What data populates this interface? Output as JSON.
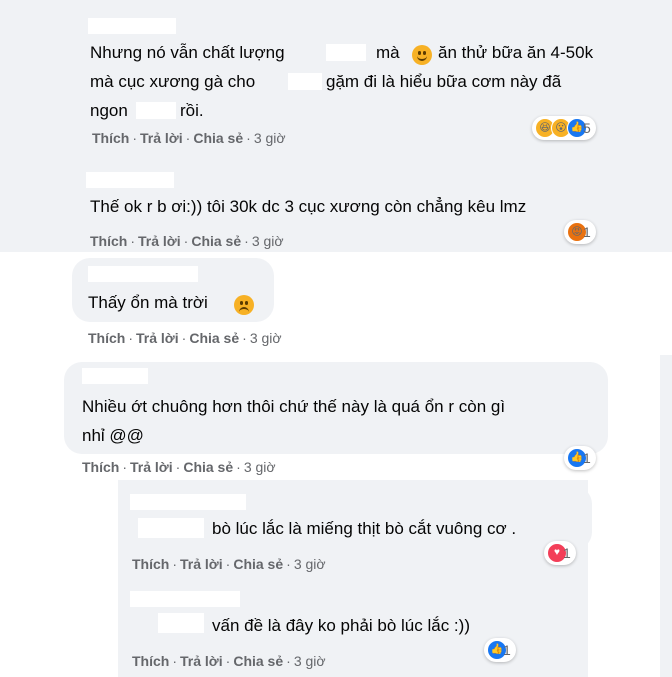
{
  "actions": {
    "like": "Thích",
    "reply": "Trả lời",
    "share": "Chia sẻ",
    "separator": "·",
    "time": "3 giờ"
  },
  "comments": [
    {
      "lines": [
        "Nhưng nó vẫn chất lượng",
        "mà",
        "ăn thử bữa ăn 4-50k",
        "mà cục xương gà cho",
        "gặm đi là hiểu bữa cơm này đã",
        "ngon",
        "rồi."
      ],
      "reactions": [
        "haha-icon",
        "wow-icon",
        "like-icon"
      ],
      "reaction_count": "5"
    },
    {
      "text": "Thế ok r b ơi:)) tôi 30k dc 3 cục xương còn chẳng kêu lmz",
      "reactions": [
        "angry-icon"
      ],
      "reaction_count": "1"
    },
    {
      "text": "Thấy ổn mà trời",
      "reactions": [],
      "reaction_count": ""
    },
    {
      "lines": [
        "Nhiều ớt chuông hơn thôi chứ thế này là quá ổn r còn gì",
        "nhỉ @@"
      ],
      "reactions": [
        "like-icon"
      ],
      "reaction_count": "1"
    },
    {
      "text": "bò lúc lắc là miếng thịt bò cắt vuông cơ .",
      "reactions": [
        "love-icon"
      ],
      "reaction_count": "1"
    },
    {
      "text": "vấn đề là đây ko phải bò lúc lắc :))",
      "reactions": [
        "like-icon"
      ],
      "reaction_count": "1"
    }
  ],
  "colors": {
    "bubble": "#f0f2f5",
    "action_text": "#65676b",
    "like_blue": "#1877f2",
    "love_red": "#f33e58",
    "emoji_yellow": "#f7b125",
    "angry_orange": "#e9710f"
  }
}
